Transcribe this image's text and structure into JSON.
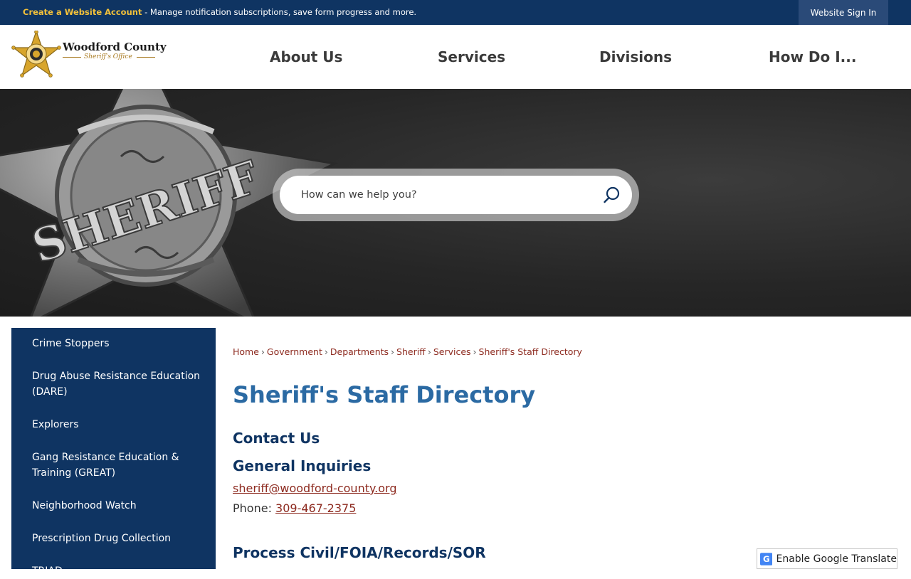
{
  "topbar": {
    "create_link": "Create a Website Account",
    "message": " - Manage notification subscriptions, save form progress and more.",
    "sign_in": "Website Sign In"
  },
  "logo": {
    "name": "Woodford County",
    "sub": "Sheriff's Office",
    "icon": "sheriff-star-icon"
  },
  "nav": {
    "items": [
      "About Us",
      "Services",
      "Divisions",
      "How Do I..."
    ]
  },
  "search": {
    "placeholder": "How can we help you?",
    "icon": "search-icon"
  },
  "sidebar": {
    "items": [
      "Crime Stoppers",
      "Drug Abuse Resistance Education (DARE)",
      "Explorers",
      "Gang Resistance Education & Training (GREAT)",
      "Neighborhood Watch",
      "Prescription Drug Collection",
      "TRIAD"
    ]
  },
  "breadcrumb": [
    "Home",
    "Government",
    "Departments",
    "Sheriff",
    "Services",
    "Sheriff's Staff Directory"
  ],
  "page": {
    "title": "Sheriff's Staff Directory",
    "contact_heading": "Contact Us",
    "general_heading": "General Inquiries",
    "email": "sheriff@woodford-county.org",
    "phone_label": "Phone: ",
    "phone": "309-467-2375",
    "process_heading": "Process Civil/FOIA/Records/SOR"
  },
  "translate": {
    "label": "Enable Google Translate",
    "icon": "google-translate-icon"
  },
  "colors": {
    "navy": "#0f3462",
    "title_blue": "#2b6aa3",
    "link_red": "#8d2a1f",
    "gold": "#f3c13a"
  }
}
